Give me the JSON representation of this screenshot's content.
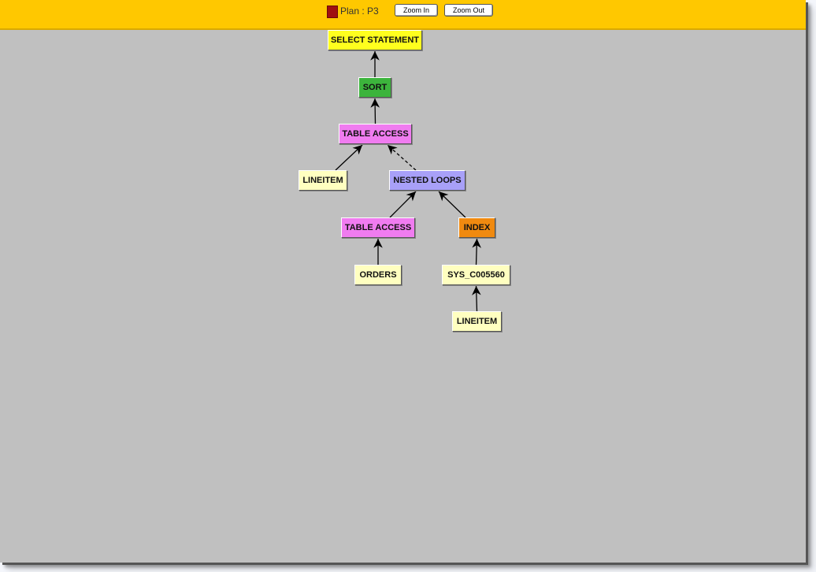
{
  "toolbar": {
    "plan_label": "Plan : P3",
    "plan_color": "#a01010",
    "zoom_in_label": "Zoom In",
    "zoom_out_label": "Zoom Out"
  },
  "colors": {
    "toolbar_bg": "#ffc800",
    "canvas_bg": "#c0c0c0",
    "select": "#ffff1e",
    "sort": "#3cb43c",
    "table_access": "#f07cf0",
    "nested_loops": "#a8a0f8",
    "index": "#f08a10",
    "object": "#ffffc0"
  },
  "nodes": [
    {
      "id": "select",
      "label": "SELECT STATEMENT",
      "kind": "select"
    },
    {
      "id": "sort",
      "label": "SORT",
      "kind": "sort"
    },
    {
      "id": "table_access_1",
      "label": "TABLE ACCESS",
      "kind": "table_access"
    },
    {
      "id": "lineitem_1",
      "label": "LINEITEM",
      "kind": "object"
    },
    {
      "id": "nested_loops",
      "label": "NESTED LOOPS",
      "kind": "nested_loops"
    },
    {
      "id": "table_access_2",
      "label": "TABLE ACCESS",
      "kind": "table_access"
    },
    {
      "id": "index",
      "label": "INDEX",
      "kind": "index"
    },
    {
      "id": "orders",
      "label": "ORDERS",
      "kind": "object"
    },
    {
      "id": "sys_c005560",
      "label": "SYS_C005560",
      "kind": "object"
    },
    {
      "id": "lineitem_2",
      "label": "LINEITEM",
      "kind": "object"
    }
  ],
  "edges": [
    {
      "from": "sort",
      "to": "select",
      "style": "solid"
    },
    {
      "from": "table_access_1",
      "to": "sort",
      "style": "solid"
    },
    {
      "from": "lineitem_1",
      "to": "table_access_1",
      "style": "solid"
    },
    {
      "from": "nested_loops",
      "to": "table_access_1",
      "style": "dashed"
    },
    {
      "from": "table_access_2",
      "to": "nested_loops",
      "style": "solid"
    },
    {
      "from": "index",
      "to": "nested_loops",
      "style": "solid"
    },
    {
      "from": "orders",
      "to": "table_access_2",
      "style": "solid"
    },
    {
      "from": "sys_c005560",
      "to": "index",
      "style": "solid"
    },
    {
      "from": "lineitem_2",
      "to": "sys_c005560",
      "style": "solid"
    }
  ]
}
